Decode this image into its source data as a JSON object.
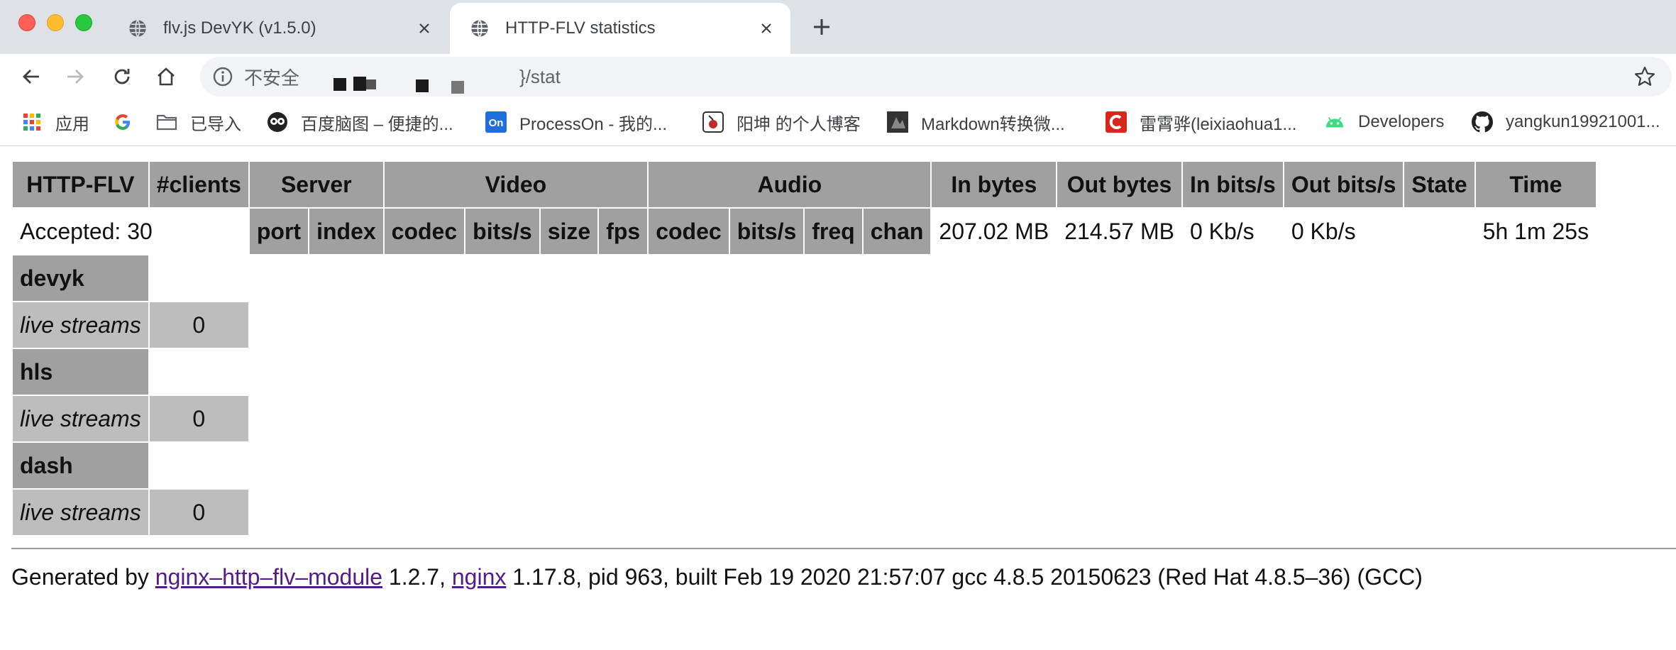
{
  "browser": {
    "tabs": [
      {
        "title": "flv.js DevYK (v1.5.0)",
        "active": false
      },
      {
        "title": "HTTP-FLV statistics",
        "active": true
      }
    ],
    "address": {
      "security_label": "不安全",
      "url_visible": "}/stat"
    },
    "bookmarks": [
      {
        "label": "应用",
        "icon": "apps-grid-icon"
      },
      {
        "label": "",
        "icon": "google-g-icon"
      },
      {
        "label": "已导入",
        "icon": "folder-icon"
      },
      {
        "label": "百度脑图 – 便捷的...",
        "icon": "owl-icon"
      },
      {
        "label": "ProcessOn - 我的...",
        "icon": "processon-icon"
      },
      {
        "label": "阳坤 的个人博客",
        "icon": "blog-icon"
      },
      {
        "label": "Markdown转换微...",
        "icon": "markdown-icon"
      },
      {
        "label": "雷霄骅(leixiaohua1...",
        "icon": "csdn-icon"
      },
      {
        "label": "Developers",
        "icon": "android-icon"
      },
      {
        "label": "yangkun19921001...",
        "icon": "github-icon"
      }
    ]
  },
  "stats": {
    "header_row1": {
      "http_flv": "HTTP-FLV",
      "clients": "#clients",
      "server": "Server",
      "video": "Video",
      "audio": "Audio",
      "in_bytes": "In bytes",
      "out_bytes": "Out bytes",
      "in_bits": "In bits/s",
      "out_bits": "Out bits/s",
      "state": "State",
      "time": "Time"
    },
    "header_row2": {
      "accepted": "Accepted: 30",
      "port": "port",
      "index": "index",
      "video_codec": "codec",
      "video_bits": "bits/s",
      "size": "size",
      "fps": "fps",
      "audio_codec": "codec",
      "audio_bits": "bits/s",
      "freq": "freq",
      "chan": "chan",
      "in_bytes": "207.02 MB",
      "out_bytes": "214.57 MB",
      "in_bits": "0 Kb/s",
      "out_bits": "0 Kb/s",
      "time": "5h 1m 25s"
    },
    "applications": [
      {
        "name": "devyk",
        "row_label": "live streams",
        "value": "0"
      },
      {
        "name": "hls",
        "row_label": "live streams",
        "value": "0"
      },
      {
        "name": "dash",
        "row_label": "live streams",
        "value": "0"
      }
    ]
  },
  "footer": {
    "prefix": "Generated by ",
    "module_link": "nginx–http–flv–module",
    "module_version": " 1.2.7, ",
    "nginx_link": "nginx",
    "suffix": " 1.17.8, pid 963, built Feb 19 2020 21:57:07 gcc 4.8.5 20150623 (Red Hat 4.8.5–36) (GCC)"
  }
}
